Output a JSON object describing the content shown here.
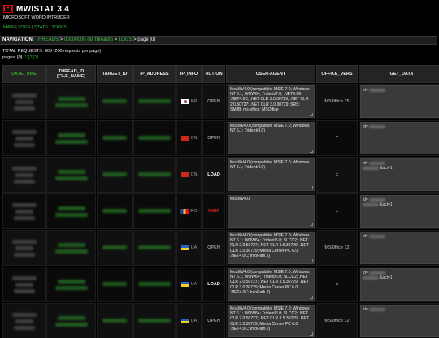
{
  "header": {
    "logo": "[•]",
    "title": "MWISTAT 3.4",
    "subtitle": "MICROSOFT WORD INTRUDER"
  },
  "top_nav": [
    {
      "label": "MAIN"
    },
    {
      "label": "LOGS"
    },
    {
      "label": "STATS"
    },
    {
      "label": "TOOLS"
    }
  ],
  "top_nav_sep": "|",
  "navbar": {
    "label": "NAVIGATION:",
    "crumbs": [
      {
        "label": "THREADS",
        "link": true
      },
      {
        "label": "00000000 (all threads)",
        "link": true
      },
      {
        "label": "LOGS",
        "link": true
      },
      {
        "label": "page [0]",
        "link": false
      }
    ],
    "sep": ">"
  },
  "totals": {
    "requests_text": "TOTAL REQUESTS: 608 (200 requests per page)",
    "pages_label": "pages:",
    "current_page": "[0]",
    "pages": [
      "[1]",
      "[2]",
      "[3]"
    ]
  },
  "columns": [
    "DATE_TIME",
    "THREAD_ID [FILE_NAME]",
    "TARGET_ID",
    "IP_ADDRESS",
    "IP_INFO",
    "ACTION",
    "USER-AGENT",
    "OFFICE_VERS",
    "GET_DATA"
  ],
  "rows": [
    {
      "country": "KR",
      "flag": "kr",
      "action": "OPEN",
      "action_style": "normal",
      "ua": "Mozilla/4.0 (compatible; MSIE 7.0; Windows NT 6.1; WOW64; Trident/7.0; .NET4.0E; .NET4.0C; .NET CLR 3.5.30729; .NET CLR 2.0.50727; .NET CLR 3.0.30729; SRS; SMJB; ms-office; MSOffice",
      "office": "MSOffice 15",
      "get": [
        "id="
      ]
    },
    {
      "country": "CN",
      "flag": "cn",
      "action": "OPEN",
      "action_style": "normal",
      "ua": "Mozilla/4.0 (compatible; MSIE 7.0; Windows NT 5.1; Trident/4.0)",
      "office": "?",
      "get": [
        "id="
      ]
    },
    {
      "country": "CN",
      "flag": "cn",
      "action": "LOAD",
      "action_style": "load",
      "ua": "Mozilla/4.0 (compatible; MSIE 7.0; Windows NT 5.1; Trident/4.0)",
      "office": "x",
      "get": [
        "id=",
        "&act=1"
      ]
    },
    {
      "country": "RO",
      "flag": "ro",
      "action": "NIMP",
      "action_style": "nimp",
      "ua": "Mozilla/4.0",
      "office": "x",
      "get": [
        "id=",
        "&act=1"
      ]
    },
    {
      "country": "UA",
      "flag": "ua",
      "action": "OPEN",
      "action_style": "normal",
      "ua": "Mozilla/4.0 (compatible; MSIE 7.0; Windows NT 6.1; WOW64; Trident/6.0; SLCC2; .NET CLR 2.0.50727; .NET CLR 3.5.30729; .NET CLR 3.0.30729; Media Center PC 6.0; .NET4.0C; InfoPath.2)",
      "office": "MSOffice 12",
      "get": [
        "id="
      ]
    },
    {
      "country": "UA",
      "flag": "ua",
      "action": "LOAD",
      "action_style": "load",
      "ua": "Mozilla/4.0 (compatible; MSIE 7.0; Windows NT 6.1; WOW64; Trident/6.0; SLCC2; .NET CLR 2.0.50727; .NET CLR 3.5.30729; .NET CLR 3.0.30729; Media Center PC 6.0; .NET4.0C; InfoPath.2)",
      "office": "x",
      "get": [
        "id=",
        "&act=1"
      ]
    },
    {
      "country": "UA",
      "flag": "ua",
      "action": "OPEN",
      "action_style": "normal",
      "ua": "Mozilla/4.0 (compatible; MSIE 7.0; Windows NT 6.1; WOW64; Trident/6.0; SLCC2; .NET CLR 2.0.50727; .NET CLR 3.5.30729; .NET CLR 3.0.30729; Media Center PC 6.0; .NET4.0C; InfoPath.2)",
      "office": "MSOffice 12",
      "get": [
        "id="
      ]
    }
  ],
  "colors": {
    "link_green": "#3dbd3d",
    "nimp_red": "#dd2222",
    "bg": "#000000",
    "header_cell": "#242424"
  }
}
